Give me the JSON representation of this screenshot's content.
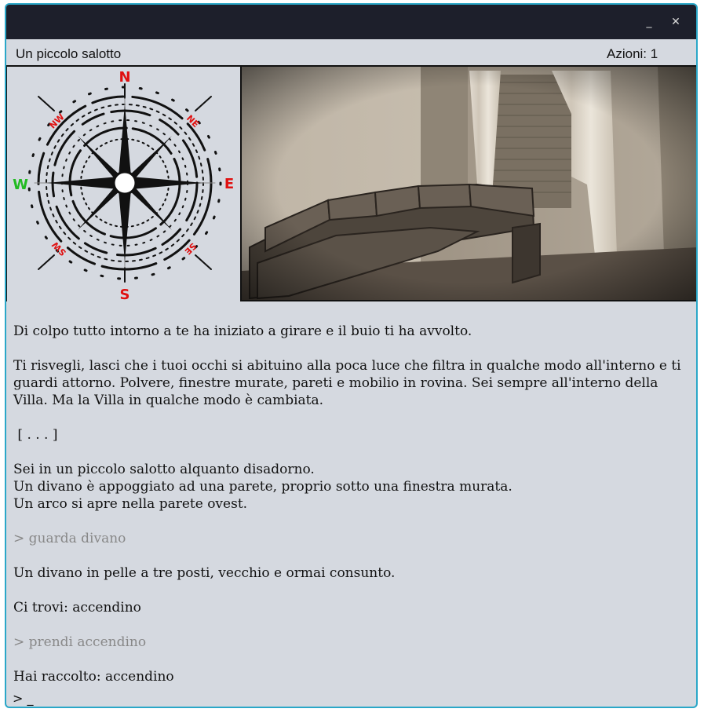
{
  "window": {
    "minimize_glyph": "_",
    "close_glyph": "✕"
  },
  "header": {
    "room_name": "Un piccolo salotto",
    "actions": "Azioni: 1"
  },
  "compass": {
    "n": "N",
    "s": "S",
    "e": "E",
    "w": "W",
    "ne": "NE",
    "nw": "NW",
    "se": "SE",
    "sw": "SW",
    "cardinal_color": "#e01010",
    "west_color": "#22bb22",
    "icon": "compass-rose-icon"
  },
  "scene": {
    "icon": "living-room-sofa-photo"
  },
  "log": [
    {
      "text": "Di colpo tutto intorno a te ha iniziato a girare e il buio ti ha avvolto.",
      "type": "text"
    },
    {
      "text": "Ti risvegli, lasci che i tuoi occhi si abituino alla poca luce che filtra in qualche modo all'interno e ti guardi attorno. Polvere, finestre murate, pareti e mobilio in rovina. Sei sempre all'interno della Villa. Ma la Villa in qualche modo è cambiata.",
      "type": "text"
    },
    {
      "text": " [ . . . ]",
      "type": "text"
    },
    {
      "text": "Sei in un piccolo salotto alquanto disadorno.\nUn divano è appoggiato ad una parete, proprio sotto una finestra murata.\nUn arco si apre nella parete ovest.",
      "type": "text"
    },
    {
      "text": "> guarda divano",
      "type": "cmd"
    },
    {
      "text": "Un divano in pelle a tre posti, vecchio e ormai consunto.",
      "type": "text"
    },
    {
      "text": "Ci trovi: accendino",
      "type": "text"
    },
    {
      "text": "> prendi accendino",
      "type": "cmd"
    },
    {
      "text": "Hai raccolto: accendino",
      "type": "text"
    }
  ],
  "prompt": {
    "text": "> _"
  }
}
